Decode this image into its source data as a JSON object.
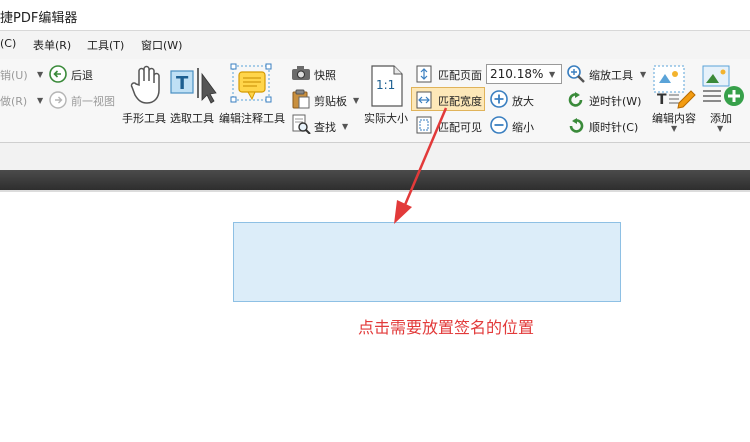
{
  "window": {
    "title": "捷PDF编辑器"
  },
  "menubar": {
    "items": [
      "(C)",
      "表单(R)",
      "工具(T)",
      "窗口(W)"
    ]
  },
  "toolbar": {
    "undo_label": "销(U)",
    "redo_label": "做(R)",
    "back_label": "后退",
    "prev_view_label": "前一视图",
    "hand_tool_label": "手形工具",
    "select_tool_label": "选取工具",
    "annot_tool_label": "编辑注释工具",
    "snapshot_label": "快照",
    "clipboard_label": "剪贴板",
    "find_label": "查找",
    "actual_size_label": "实际大小",
    "actual_size_glyph": "1:1",
    "fit_page_label": "匹配页面",
    "fit_width_label": "匹配宽度",
    "fit_visible_label": "匹配可见",
    "zoom_value": "210.18%",
    "zoom_tool_label": "缩放工具",
    "zoom_in_label": "放大",
    "zoom_out_label": "缩小",
    "rotate_ccw_label": "逆时针(W)",
    "rotate_cw_label": "顺时针(C)",
    "edit_content_label": "编辑内容",
    "add_label": "添加"
  },
  "document": {
    "instruction": "点击需要放置签名的位置"
  },
  "colors": {
    "accent": "#e23a3a",
    "highlight": "#fde8b8",
    "signature_box": "#dcedf9"
  }
}
